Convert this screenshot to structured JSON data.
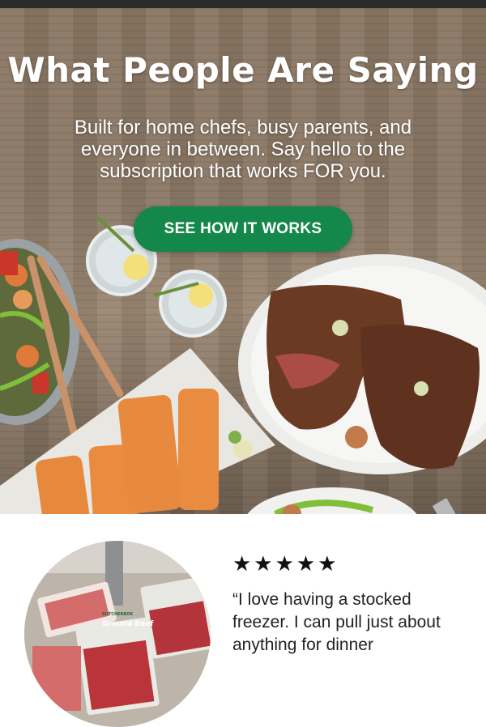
{
  "hero": {
    "title": "What People Are Saying",
    "subtitle": "Built for home chefs, busy parents, and everyone in between. Say hello to the subscription that works FOR you.",
    "cta_label": "SEE HOW IT WORKS"
  },
  "review": {
    "stars": "★★★★★",
    "rating": 5,
    "quote": "“I love having a stocked freezer.  I can pull just about anything for dinner",
    "package_brand": "BUTCHERBOX",
    "package_label": "Ground Beef"
  },
  "colors": {
    "cta_background": "#14884a",
    "top_bar": "#2b2b2b",
    "wood": "#8a7763"
  },
  "icons": [
    "star-icon"
  ]
}
